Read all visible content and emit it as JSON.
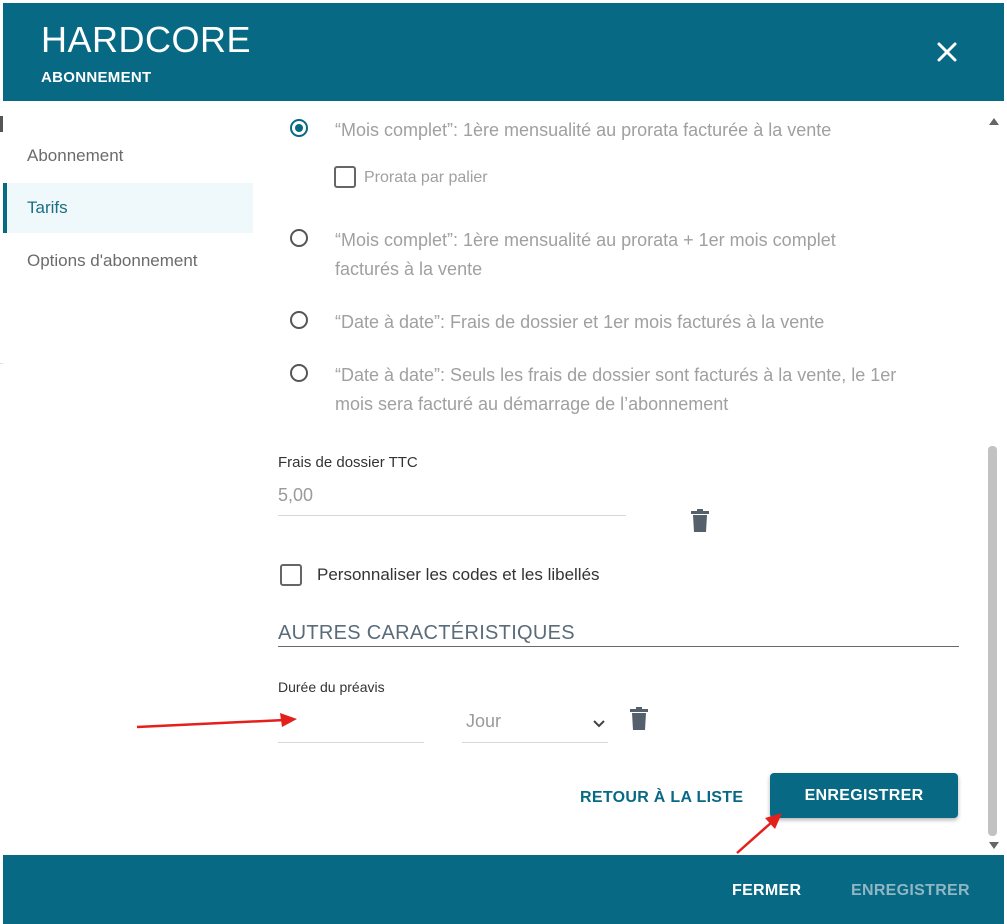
{
  "header": {
    "title": "HARDCORE",
    "subtitle": "ABONNEMENT"
  },
  "sidebar": {
    "items": [
      {
        "label": "Abonnement"
      },
      {
        "label": "Tarifs"
      },
      {
        "label": "Options d'abonnement"
      }
    ]
  },
  "billing_options": [
    {
      "text": "“Mois complet”: 1ère mensualité au prorata facturée à la vente",
      "checked": true
    },
    {
      "text": "Prorata par palier"
    },
    {
      "line1": "“Mois complet”: 1ère mensualité au prorata + 1er mois complet",
      "line2": "facturés à la vente"
    },
    {
      "text": "“Date à date”: Frais de dossier et 1er mois facturés à la vente"
    },
    {
      "line1": "“Date à date”: Seuls les frais de dossier sont facturés à la vente, le 1er",
      "line2": "mois sera facturé au démarrage de l’abonnement"
    }
  ],
  "fees": {
    "label": "Frais de dossier TTC",
    "value": "5,00"
  },
  "customize": {
    "label": "Personnaliser les codes et les libellés"
  },
  "other": {
    "title": "AUTRES CARACTÉRISTIQUES",
    "notice_label": "Durée du préavis",
    "notice_value": "",
    "unit_value": "Jour"
  },
  "actions": {
    "back": "RETOUR À LA LISTE",
    "save": "ENREGISTRER"
  },
  "footer": {
    "close": "FERMER",
    "save": "ENREGISTRER"
  },
  "colors": {
    "primary": "#086985",
    "annotation": "#e3201b"
  }
}
